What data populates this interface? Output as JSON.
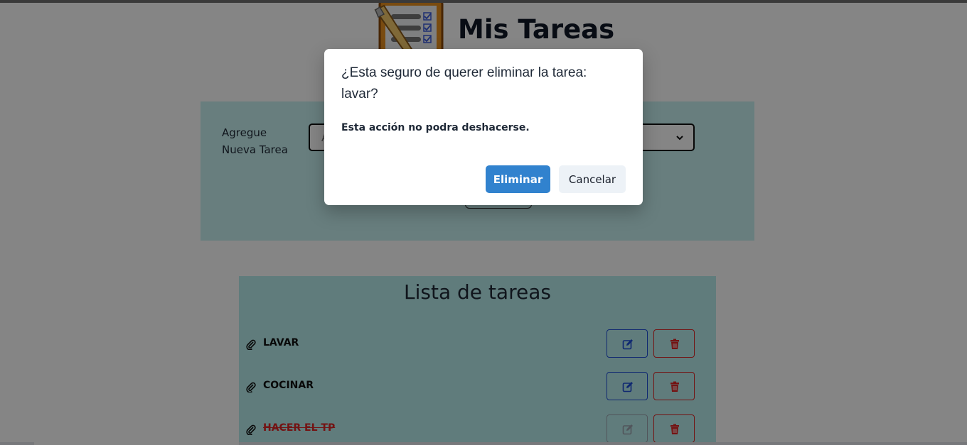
{
  "header": {
    "title": "Mis Tareas",
    "logo_icon": "clipboard-checklist-icon"
  },
  "form": {
    "label": "Agregue Nueva Tarea",
    "input_placeholder": "A",
    "select_value": ""
  },
  "list": {
    "title": "Lista de tareas",
    "tasks": [
      {
        "text": "LAVAR",
        "completed": false
      },
      {
        "text": "COCINAR",
        "completed": false
      },
      {
        "text": "HACER EL TP",
        "completed": true
      }
    ]
  },
  "modal": {
    "title": "¿Esta seguro de querer eliminar la tarea: lavar?",
    "body": "Esta acción no podra deshacerse.",
    "confirm_label": "Eliminar",
    "cancel_label": "Cancelar"
  },
  "colors": {
    "card_bg": "#c7f2f2",
    "primary": "#3182ce",
    "danger": "#dc2626",
    "edit": "#1d4ed8"
  }
}
